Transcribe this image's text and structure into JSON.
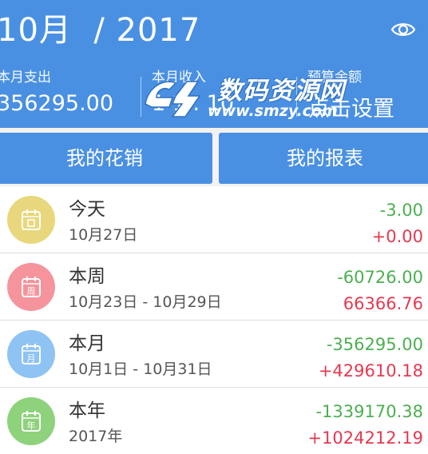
{
  "header": {
    "month_title": "10月  / 2017",
    "background": "#4a90e2",
    "eye_icon": "eye-icon",
    "expense_label": "本月支出",
    "expense_value": "356295.00",
    "income_label": "本月收入",
    "income_value": "1 1 . 10",
    "budget_label": "预算余额",
    "budget_action": "点击设置"
  },
  "watermark": {
    "brand": "数码资源网",
    "url": "www.smzy.com"
  },
  "tabs": [
    {
      "label": "我的花销"
    },
    {
      "label": "我的报表"
    }
  ],
  "rows": [
    {
      "title": "今天",
      "subtitle": "10月27日",
      "expense": "-3.00",
      "income": "+0.00",
      "icon_color": "#e8d77c",
      "icon_glyph": "",
      "icon": "calendar-icon"
    },
    {
      "title": "本周",
      "subtitle": "10月23日 - 10月29日",
      "expense": "-60726.00",
      "income": "66366.76",
      "icon_color": "#f5949c",
      "icon_glyph": "周",
      "icon": "calendar-week-icon"
    },
    {
      "title": "本月",
      "subtitle": "10月1日 - 10月31日",
      "expense": "-356295.00",
      "income": "+429610.18",
      "icon_color": "#8ec3f3",
      "icon_glyph": "月",
      "icon": "calendar-month-icon"
    },
    {
      "title": "本年",
      "subtitle": "2017年",
      "expense": "-1339170.38",
      "income": "+1024212.19",
      "icon_color": "#8ed27c",
      "icon_glyph": "年",
      "icon": "calendar-year-icon"
    }
  ],
  "colors": {
    "expense": "#4caf50",
    "income": "#e53950"
  }
}
